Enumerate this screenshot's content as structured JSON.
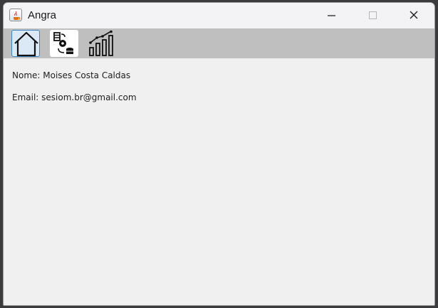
{
  "window": {
    "title": "Angra",
    "app_icon": "java-coffee-cup-icon",
    "controls": [
      "minimize-icon",
      "maximize-icon",
      "close-icon"
    ]
  },
  "toolbar": {
    "buttons": [
      {
        "name": "home",
        "icon": "home-icon",
        "selected": true
      },
      {
        "name": "settings-database",
        "icon": "gear-database-icon",
        "selected": false
      },
      {
        "name": "chart",
        "icon": "bar-chart-growth-icon",
        "selected": false
      }
    ]
  },
  "user": {
    "name_line": "Nome: Moises Costa Caldas",
    "email_line": "Email: sesiom.br@gmail.com"
  },
  "colors": {
    "toolbar_bg": "#bfbfbf",
    "selected_border": "#3a86c8",
    "content_bg": "#f0f0f0"
  }
}
